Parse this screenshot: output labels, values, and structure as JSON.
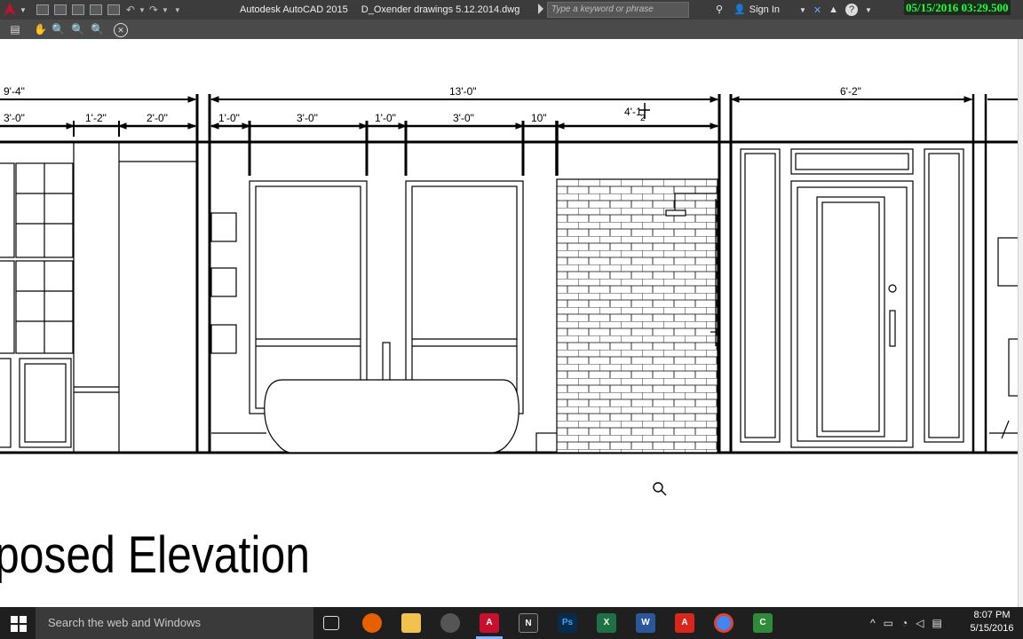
{
  "app": {
    "name": "Autodesk AutoCAD 2015",
    "file": "D_Oxender drawings 5.12.2014.dwg",
    "search_placeholder": "Type a keyword or phrase",
    "sign_in": "Sign In",
    "help": "?",
    "timestamp_overlay": "05/15/2016 03:29.500"
  },
  "quick_access_icons": [
    "new-icon",
    "open-icon",
    "save-icon",
    "saveas-icon",
    "plot-icon",
    "undo-icon",
    "redo-icon",
    "customize-icon"
  ],
  "view_toolbar_icons": [
    "print-icon",
    "pan-icon",
    "zoom-realtime-icon",
    "zoom-window-icon",
    "zoom-previous-icon",
    "close-icon"
  ],
  "drawing": {
    "title": "posed Elevation",
    "dimensions": {
      "overall_left": "9'-4\"",
      "overall_center": "13'-0\"",
      "overall_right": "6'-2\"",
      "left_a": "3'-0\"",
      "left_b": "1'-2\"",
      "left_c": "2'-0\"",
      "mid_a": "1'-0\"",
      "mid_b": "3'-0\"",
      "mid_c": "1'-0\"",
      "mid_d": "3'-0\"",
      "mid_e": "10\"",
      "mid_f": "4'-1",
      "mid_f_frac": "2"
    }
  },
  "taskbar": {
    "search_placeholder": "Search the web and Windows",
    "apps": [
      "task-view-icon",
      "firefox-icon",
      "file-explorer-icon",
      "steam-icon",
      "autocad-icon",
      "navisworks-icon",
      "photoshop-icon",
      "excel-icon",
      "word-icon",
      "acrobat-icon",
      "chrome-icon",
      "camtasia-icon"
    ],
    "clock_time": "8:07 PM",
    "clock_date": "5/15/2016"
  },
  "colors": {
    "title_bar": "#3c3c3c",
    "timestamp_text": "#1fff3a",
    "autocad_red": "#c8102e",
    "taskbar": "#1f1f1f"
  }
}
